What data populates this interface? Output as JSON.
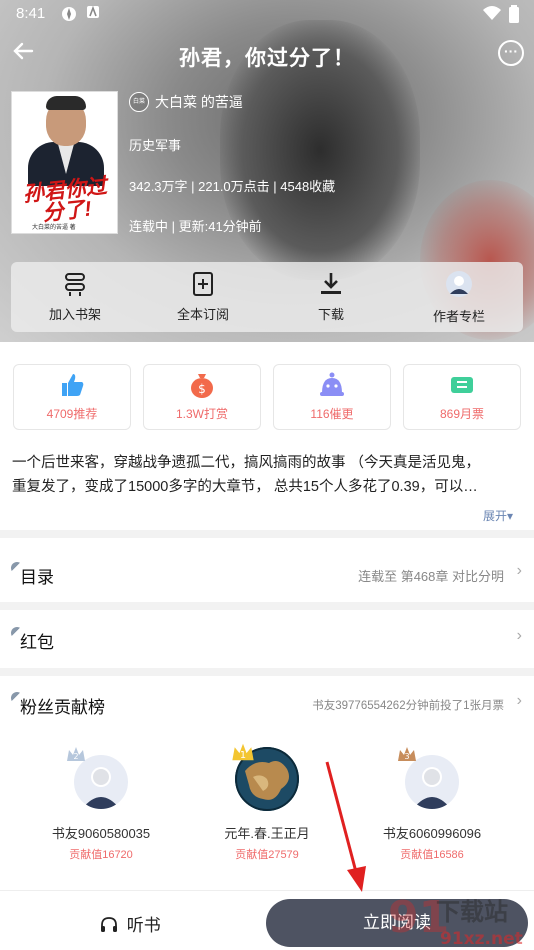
{
  "status": {
    "time": "8:41"
  },
  "header": {
    "title": "孙君，你过分了！"
  },
  "book": {
    "cover_title": "孙君你过分了!",
    "cover_author": "大白菜的苦逼 著",
    "author_badge": "白菜",
    "author": "大白菜 的苦逼",
    "category": "历史军事",
    "stats_line": "342.3万字 | 221.0万点击 | 4548收藏",
    "status_line": "连载中 | 更新:41分钟前"
  },
  "actions": [
    {
      "label": "加入书架",
      "icon": "bookshelf-icon"
    },
    {
      "label": "全本订阅",
      "icon": "subscribe-icon"
    },
    {
      "label": "下载",
      "icon": "download-icon"
    },
    {
      "label": "作者专栏",
      "icon": "author-avatar-icon"
    }
  ],
  "stats": [
    {
      "label": "4709推荐",
      "icon": "thumbs-up-icon",
      "color": "#3fa3f5"
    },
    {
      "label": "1.3W打赏",
      "icon": "money-bag-icon",
      "color": "#f26a4b"
    },
    {
      "label": "116催更",
      "icon": "alarm-face-icon",
      "color": "#8b8ef5"
    },
    {
      "label": "869月票",
      "icon": "ticket-icon",
      "color": "#3fcf9a"
    }
  ],
  "intro": {
    "line1": "一个后世来客，穿越战争遗孤二代，搞风搞雨的故事 （今天真是活见鬼，",
    "line2": "重复发了，变成了15000多字的大章节， 总共15个人多花了0.39，可以…",
    "expand": "展开▾"
  },
  "catalog": {
    "title": "目录",
    "info": "连载至 第468章 对比分明"
  },
  "redpacket": {
    "title": "红包"
  },
  "fans": {
    "title": "粉丝贡献榜",
    "info": "书友39776554262分钟前投了1张月票",
    "list": [
      {
        "name": "书友9060580035",
        "score": "贡献值16720",
        "crown_color": "#b6c7dc"
      },
      {
        "name": "元年.春.王正月",
        "score": "贡献值27579",
        "crown_color": "#f3c531"
      },
      {
        "name": "书友6060996096",
        "score": "贡献值16586",
        "crown_color": "#c78d5c"
      }
    ]
  },
  "bottom": {
    "listen": "听书",
    "read": "立即阅读"
  },
  "watermark": {
    "big": "下载站",
    "url": "91xz.net",
    "num": "91"
  }
}
